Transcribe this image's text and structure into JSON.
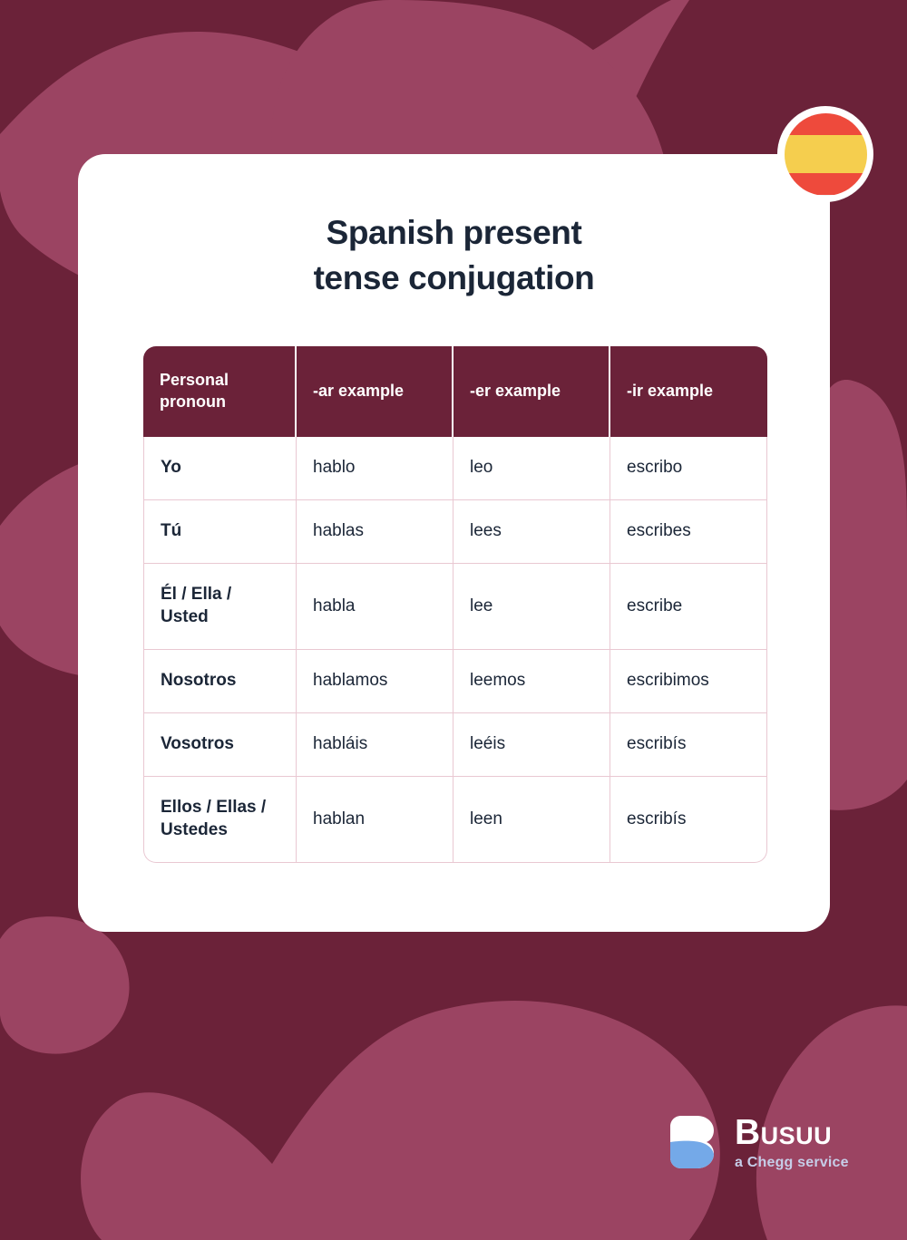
{
  "theme": {
    "background_color": "#6B2239",
    "blob_color": "#9B4462",
    "card_color": "#FFFFFF",
    "title_color": "#1B2637",
    "table_header_bg": "#6B2239",
    "table_border_color": "#E9C8D2",
    "flag_red": "#EE4A3C",
    "flag_yellow": "#F5CE4E",
    "logo_blue": "#74A9E8",
    "tagline_color": "#C6CDE8"
  },
  "badge": {
    "icon": "spain-flag-icon",
    "label": "Spain flag"
  },
  "card": {
    "title_line_1": "Spanish present",
    "title_line_2": "tense conjugation"
  },
  "table": {
    "headers": [
      "Personal pronoun",
      "-ar example",
      "-er example",
      "-ir example"
    ],
    "rows": [
      {
        "pronoun": "Yo",
        "ar": "hablo",
        "er": "leo",
        "ir": "escribo",
        "tall": false
      },
      {
        "pronoun": "Tú",
        "ar": "hablas",
        "er": "lees",
        "ir": "escribes",
        "tall": false
      },
      {
        "pronoun": "Él / Ella / Usted",
        "ar": "habla",
        "er": "lee",
        "ir": "escribe",
        "tall": true
      },
      {
        "pronoun": "Nosotros",
        "ar": "hablamos",
        "er": "leemos",
        "ir": "escribimos",
        "tall": false
      },
      {
        "pronoun": "Vosotros",
        "ar": "habláis",
        "er": "leéis",
        "ir": "escribís",
        "tall": false
      },
      {
        "pronoun": "Ellos / Ellas / Ustedes",
        "ar": "hablan",
        "er": "leen",
        "ir": "escribís",
        "tall": true
      }
    ]
  },
  "footer": {
    "logo_mark_icon": "busuu-b-logo-icon",
    "wordmark": "Busuu",
    "tagline": "a Chegg service"
  }
}
